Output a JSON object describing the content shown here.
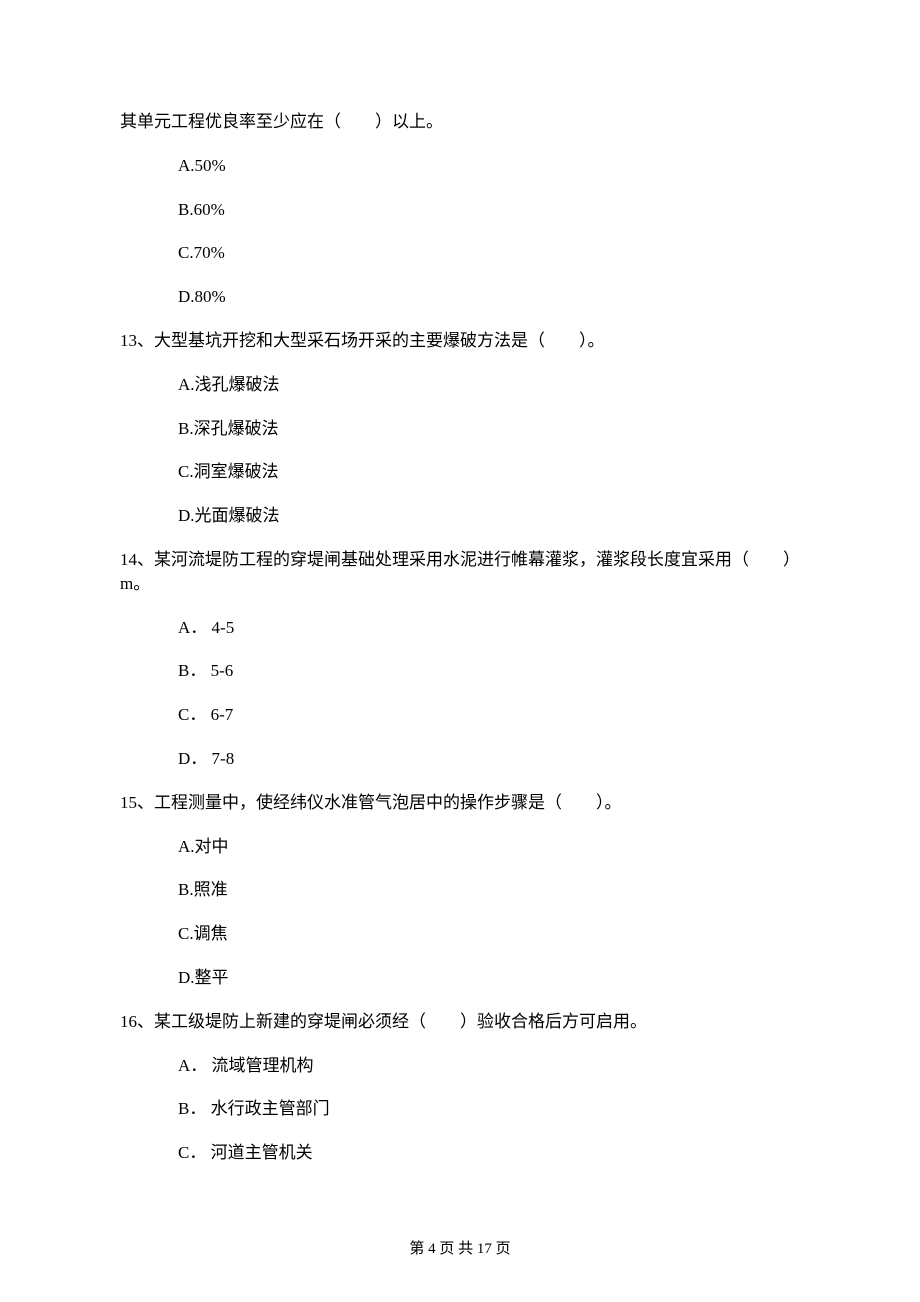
{
  "q12_cont": "其单元工程优良率至少应在（　　）以上。",
  "q12_a": "A.50%",
  "q12_b": "B.60%",
  "q12_c": "C.70%",
  "q12_d": "D.80%",
  "q13_stem": "13、大型基坑开挖和大型采石场开采的主要爆破方法是（　　）。",
  "q13_a": "A.浅孔爆破法",
  "q13_b": "B.深孔爆破法",
  "q13_c": "C.洞室爆破法",
  "q13_d": "D.光面爆破法",
  "q14_stem": "14、某河流堤防工程的穿堤闸基础处理采用水泥进行帷幕灌浆，灌浆段长度宜采用（　　） m。",
  "q14_a": "A． 4-5",
  "q14_b": "B． 5-6",
  "q14_c": "C． 6-7",
  "q14_d": "D． 7-8",
  "q15_stem": "15、工程测量中，使经纬仪水准管气泡居中的操作步骤是（　　）。",
  "q15_a": "A.对中",
  "q15_b": "B.照准",
  "q15_c": "C.调焦",
  "q15_d": "D.整平",
  "q16_stem": "16、某工级堤防上新建的穿堤闸必须经（　　）验收合格后方可启用。",
  "q16_a": "A． 流域管理机构",
  "q16_b": "B． 水行政主管部门",
  "q16_c": "C． 河道主管机关",
  "footer": "第 4 页 共 17 页"
}
